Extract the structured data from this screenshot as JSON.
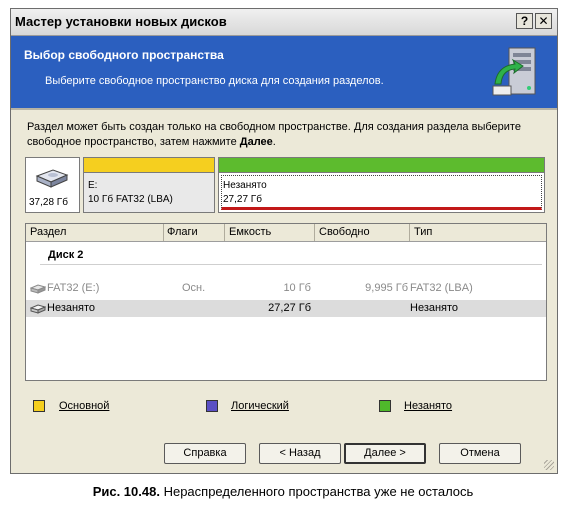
{
  "window": {
    "title": "Мастер установки новых дисков",
    "help_button": "?",
    "close_button": "✕"
  },
  "header": {
    "title": "Выбор свободного пространства",
    "subtitle": "Выберите свободное пространство диска для создания разделов."
  },
  "instruction": {
    "text": "Раздел может быть создан только на свободном пространстве. Для создания раздела выберите свободное пространство, затем нажмите",
    "emphasis": "Далее",
    "end": "."
  },
  "disk_map": {
    "disk_size": "37,28 Гб",
    "partitions": [
      {
        "line1": "E:",
        "line2": "10 Гб  FAT32 (LBA)",
        "color": "#f5cf1f"
      },
      {
        "line1": "Незанято",
        "line2": "27,27 Гб",
        "color": "#5dbb2e"
      }
    ]
  },
  "list": {
    "columns": [
      "Раздел",
      "Флаги",
      "Емкость",
      "Свободно",
      "Тип"
    ],
    "group": "Диск 2",
    "rows": [
      {
        "name": "FAT32 (E:)",
        "flags": "Осн.",
        "capacity": "10 Гб",
        "free": "9,995 Гб",
        "type": "FAT32 (LBA)",
        "state": "disabled"
      },
      {
        "name": "Незанято",
        "flags": "",
        "capacity": "27,27 Гб",
        "free": "",
        "type": "Незанято",
        "state": "selected"
      }
    ]
  },
  "legend": [
    {
      "label": "Основной",
      "color": "#f5cf1f"
    },
    {
      "label": "Логический",
      "color": "#5a4fc4"
    },
    {
      "label": "Незанято",
      "color": "#4fb82b"
    }
  ],
  "buttons": {
    "help": "Справка",
    "back": "< Назад",
    "next": "Далее >",
    "cancel": "Отмена"
  },
  "caption": {
    "label": "Рис. 10.48.",
    "text": "Нераспределенного пространства уже не осталось"
  }
}
